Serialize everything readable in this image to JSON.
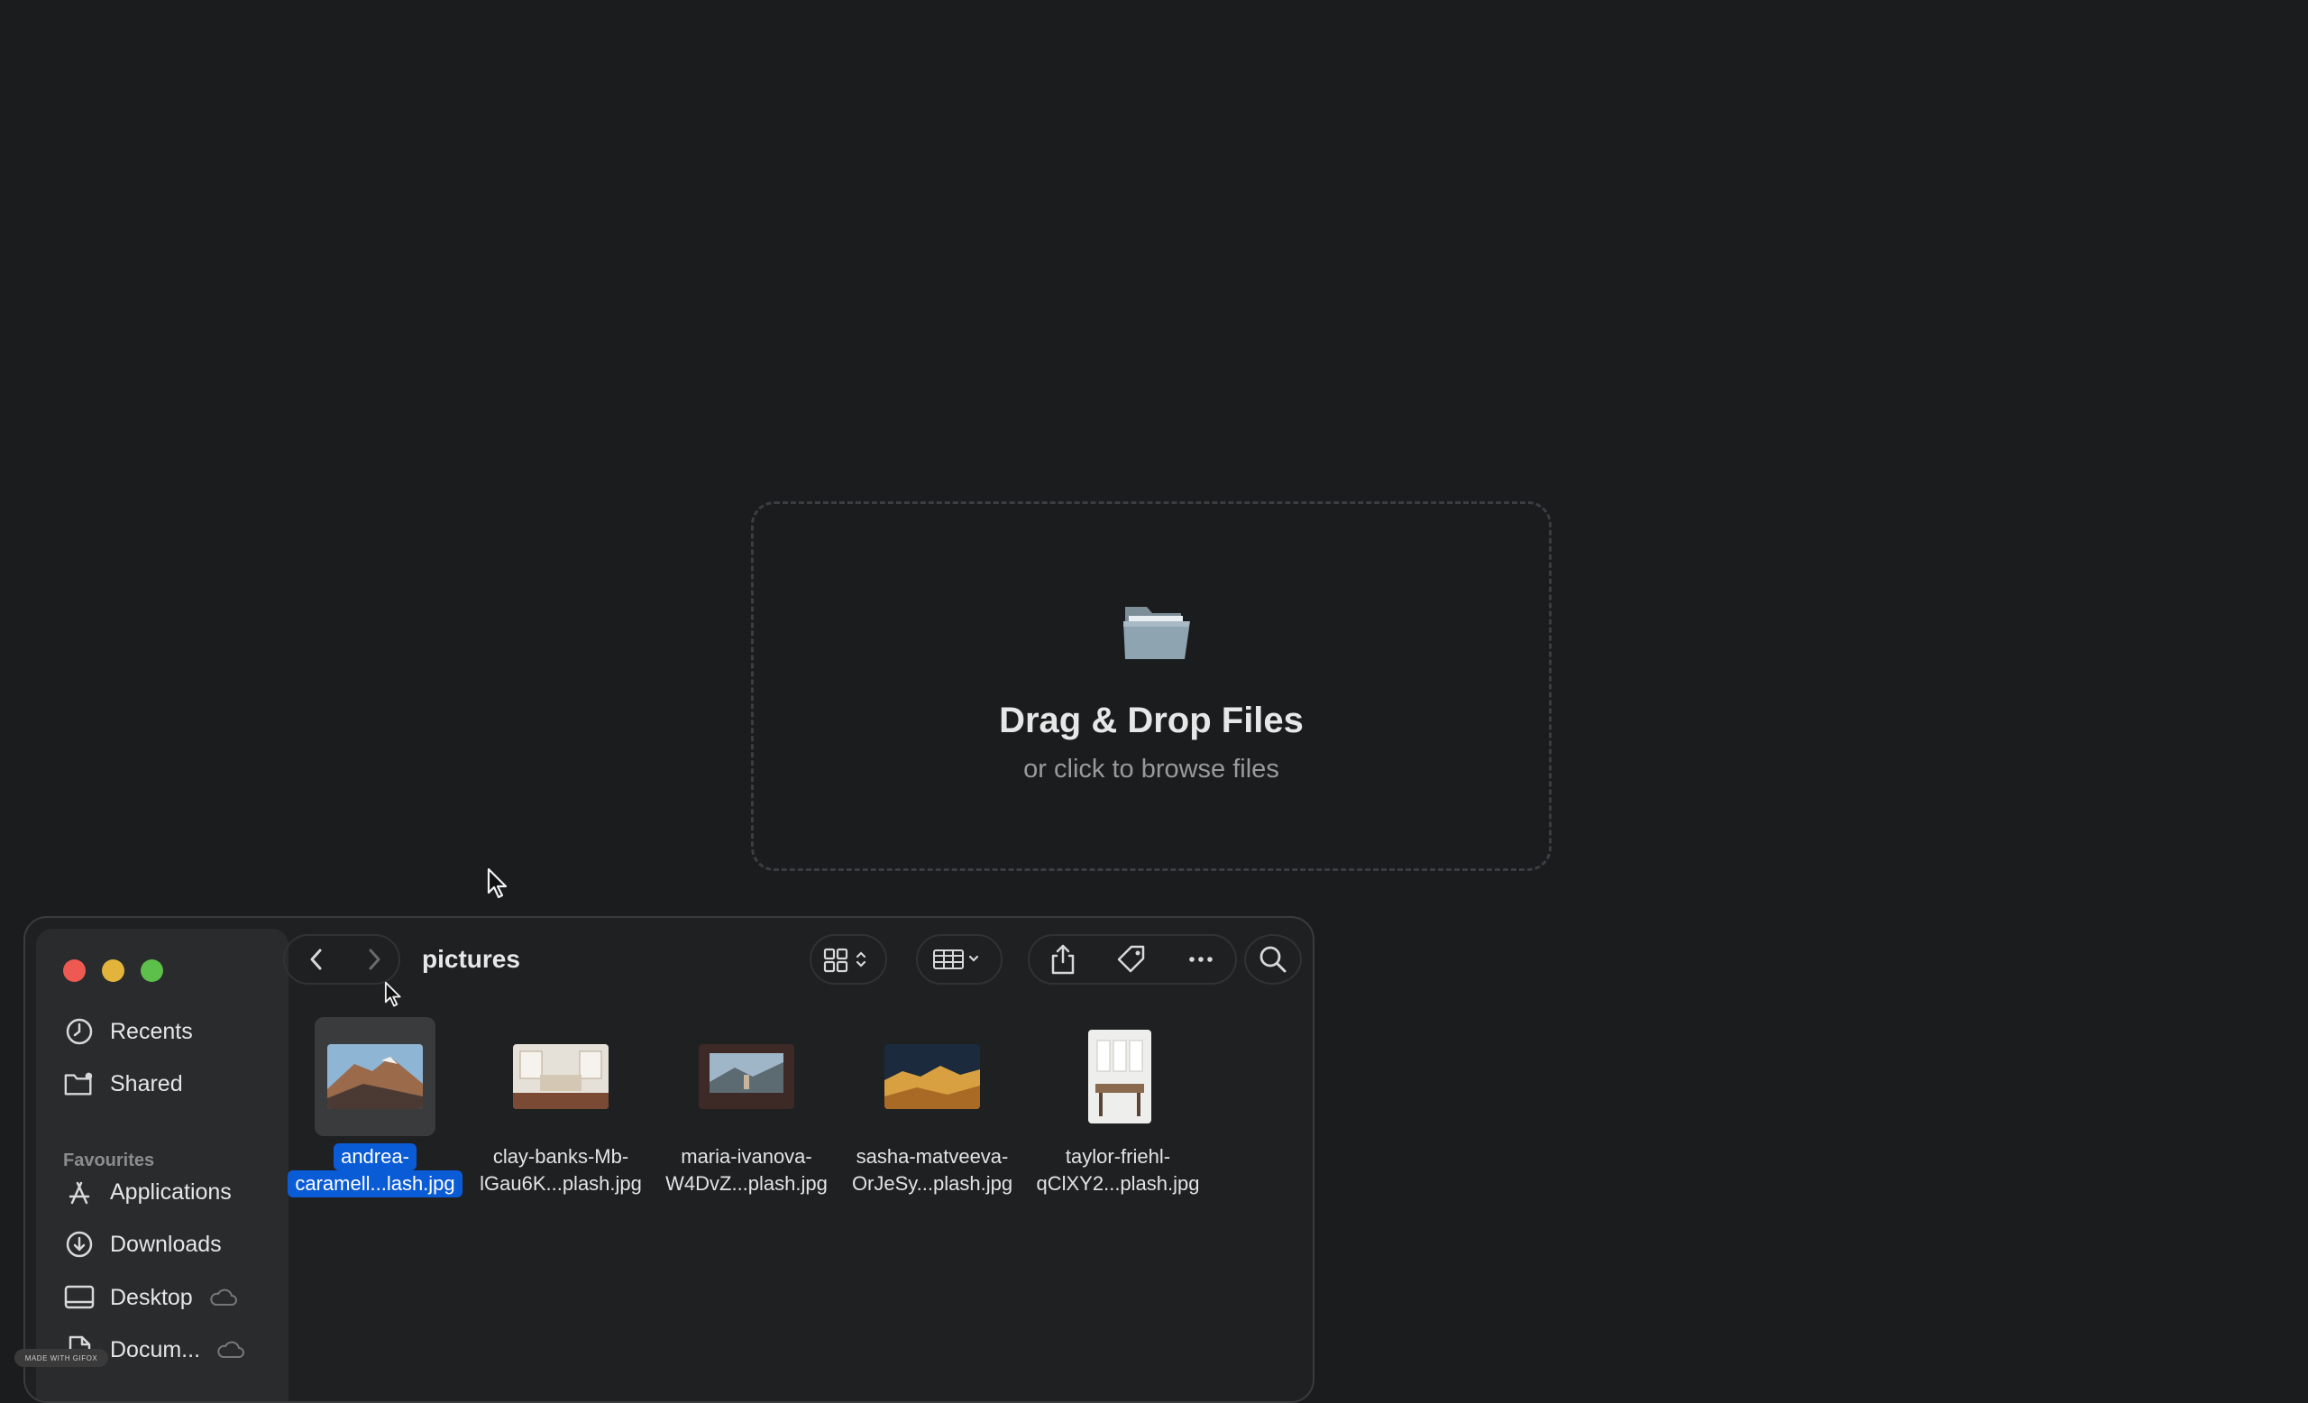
{
  "dropzone": {
    "icon": "folder-icon",
    "title": "Drag & Drop Files",
    "subtitle": "or click to browse files"
  },
  "finder": {
    "folder_title": "pictures",
    "sidebar": {
      "items": [
        {
          "label": "Recents",
          "icon": "clock-icon"
        },
        {
          "label": "Shared",
          "icon": "shared-folder-icon"
        }
      ],
      "favourites_label": "Favourites",
      "favourites": [
        {
          "label": "Applications",
          "icon": "applications-icon"
        },
        {
          "label": "Downloads",
          "icon": "download-icon"
        },
        {
          "label": "Desktop",
          "icon": "desktop-icon",
          "cloud": true
        },
        {
          "label": "Docum...",
          "icon": "document-icon",
          "cloud": true
        }
      ]
    },
    "toolbar": {
      "back": "chevron-left-icon",
      "forward": "chevron-right-icon",
      "view": "grid-view-icon",
      "group": "group-icon",
      "share": "share-icon",
      "tag": "tag-icon",
      "more": "more-icon",
      "search": "search-icon"
    },
    "files": [
      {
        "line1": "andrea-",
        "line2": "caramell...lash.jpg",
        "selected": true
      },
      {
        "line1": "clay-banks-Mb-",
        "line2": "lGau6K...plash.jpg",
        "selected": false
      },
      {
        "line1": "maria-ivanova-",
        "line2": "W4DvZ...plash.jpg",
        "selected": false
      },
      {
        "line1": "sasha-matveeva-",
        "line2": "OrJeSy...plash.jpg",
        "selected": false
      },
      {
        "line1": "taylor-friehl-",
        "line2": "qClXY2...plash.jpg",
        "selected": false
      }
    ]
  },
  "watermark": "MADE WITH GIFOX"
}
